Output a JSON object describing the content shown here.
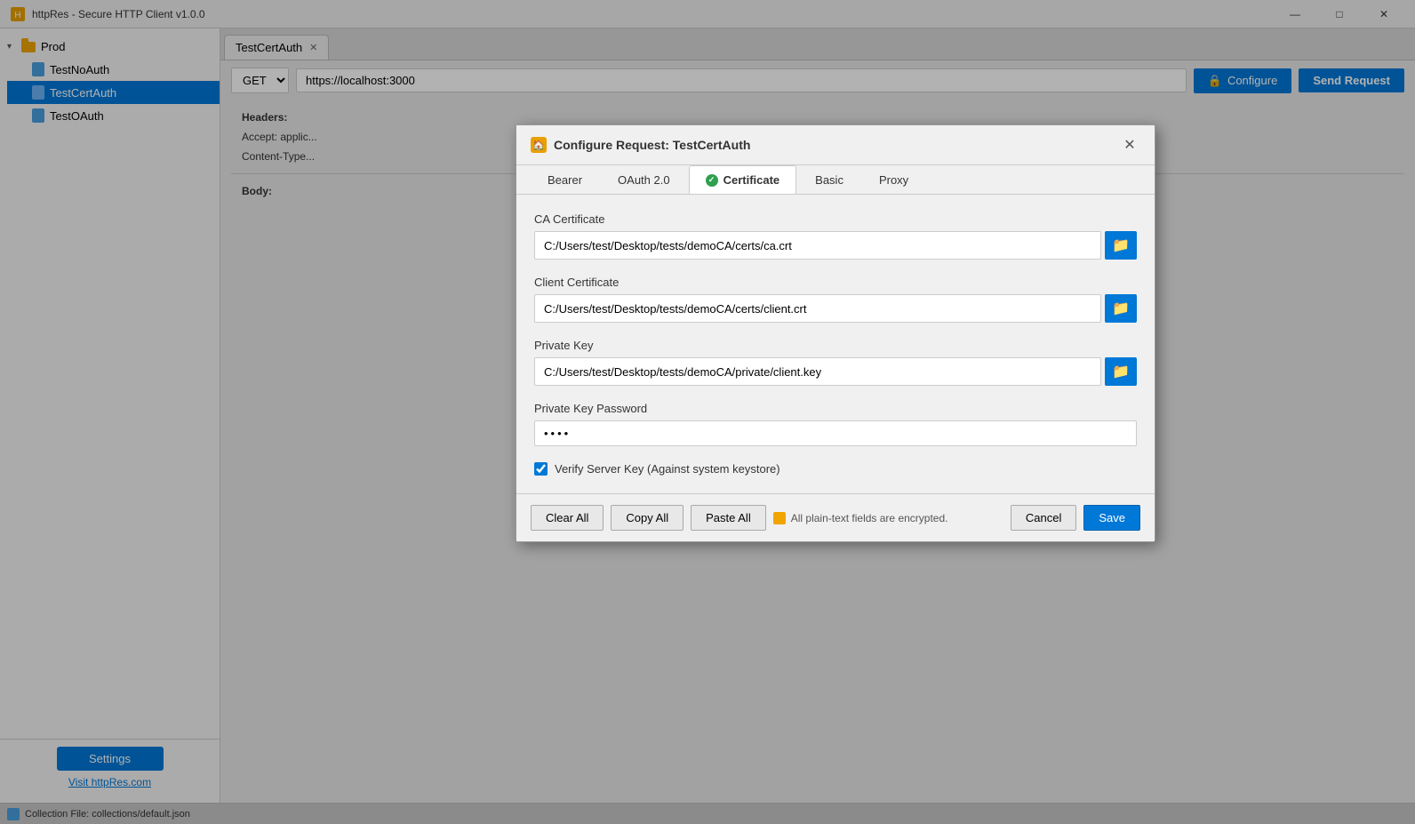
{
  "titlebar": {
    "title": "httpRes - Secure HTTP Client v1.0.0",
    "minimize": "—",
    "maximize": "□",
    "close": "✕"
  },
  "sidebar": {
    "prod_label": "Prod",
    "items": [
      {
        "id": "TestNoAuth",
        "label": "TestNoAuth",
        "active": false
      },
      {
        "id": "TestCertAuth",
        "label": "TestCertAuth",
        "active": true
      },
      {
        "id": "TestOAuth",
        "label": "TestOAuth",
        "active": false
      }
    ],
    "settings_label": "Settings",
    "visit_label": "Visit httpRes.com"
  },
  "tab": {
    "label": "TestCertAuth",
    "close": "✕"
  },
  "request": {
    "method": "GET",
    "url": "https://localhost:3000",
    "configure_label": "Configure",
    "send_label": "Send Request"
  },
  "headers": {
    "label": "Headers:",
    "line1": "Accept: applic...",
    "line2": "Content-Type..."
  },
  "body": {
    "label": "Body:"
  },
  "dialog": {
    "title": "Configure Request: TestCertAuth",
    "icon": "🏠",
    "tabs": [
      {
        "id": "bearer",
        "label": "Bearer",
        "active": false
      },
      {
        "id": "oauth2",
        "label": "OAuth 2.0",
        "active": false
      },
      {
        "id": "certificate",
        "label": "Certificate",
        "active": true
      },
      {
        "id": "basic",
        "label": "Basic",
        "active": false
      },
      {
        "id": "proxy",
        "label": "Proxy",
        "active": false
      }
    ],
    "ca_cert_label": "CA Certificate",
    "ca_cert_value": "C:/Users/test/Desktop/tests/demoCA/certs/ca.crt",
    "client_cert_label": "Client Certificate",
    "client_cert_value": "C:/Users/test/Desktop/tests/demoCA/certs/client.crt",
    "private_key_label": "Private Key",
    "private_key_value": "C:/Users/test/Desktop/tests/demoCA/private/client.key",
    "password_label": "Private Key Password",
    "password_value": "••••",
    "verify_label": "Verify Server Key (Against system keystore)",
    "footer": {
      "clear_all": "Clear All",
      "copy_all": "Copy All",
      "paste_all": "Paste All",
      "encrypted_msg": "All plain-text fields are encrypted.",
      "cancel": "Cancel",
      "save": "Save"
    }
  },
  "statusbar": {
    "text": "Collection File: collections/default.json"
  }
}
